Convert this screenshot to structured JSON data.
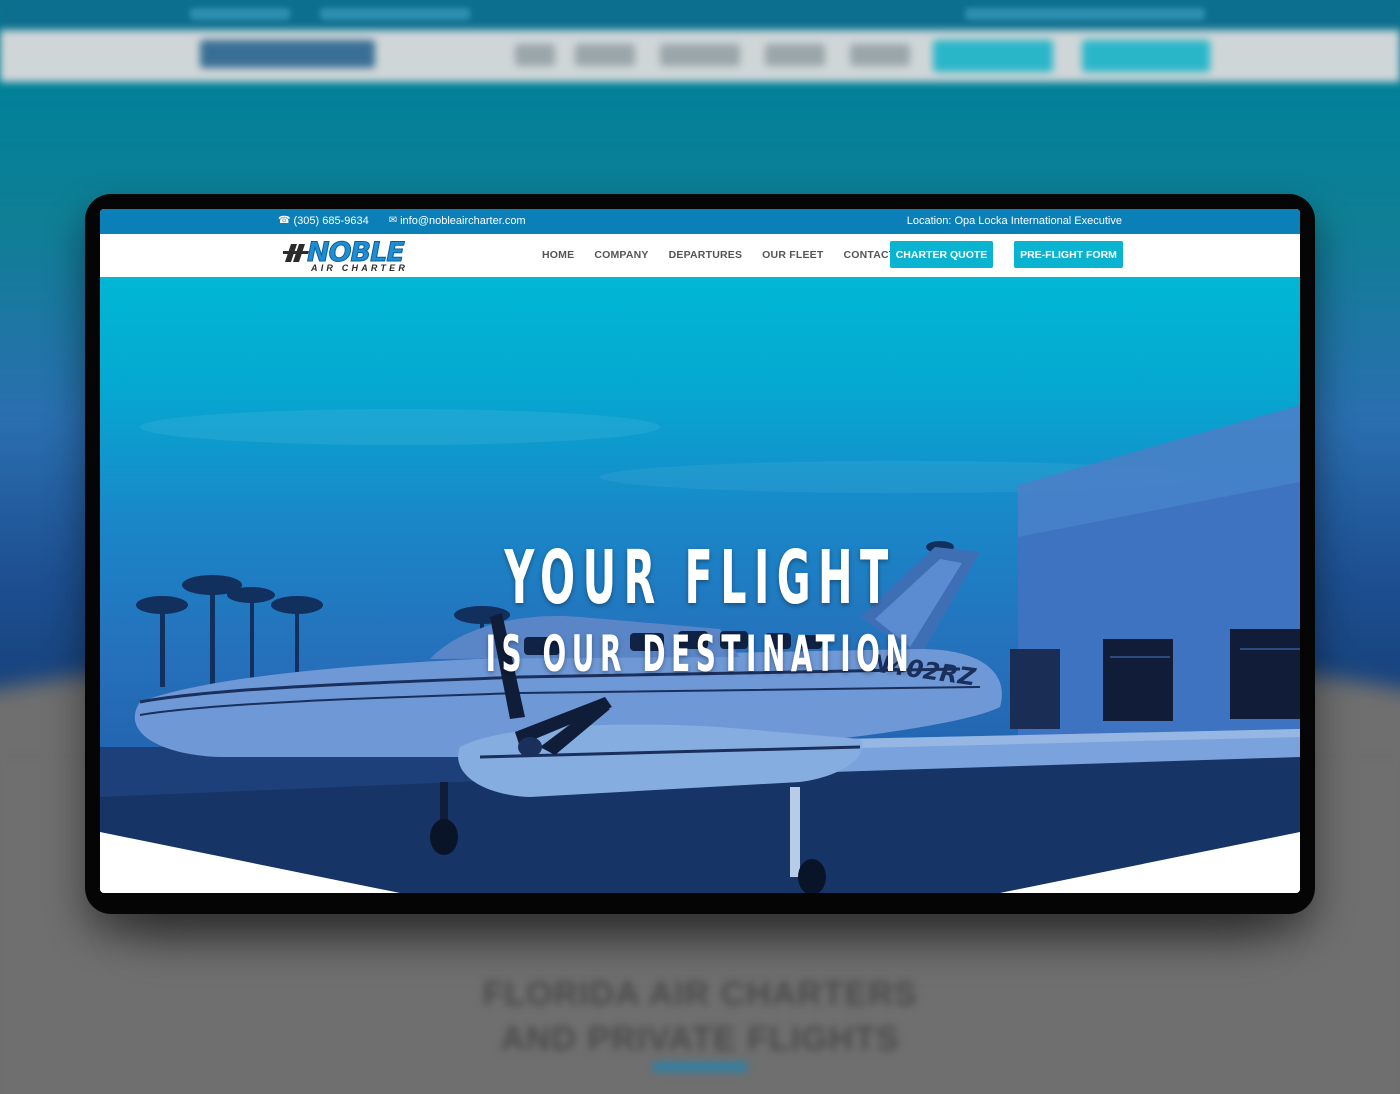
{
  "topbar": {
    "phone": "(305) 685-9634",
    "phone_icon": "phone-icon",
    "email": "info@nobleaircharter.com",
    "email_icon": "envelope-icon",
    "location": "Location: Opa Locka International Executive"
  },
  "brand": {
    "name": "NOBLE",
    "tagline": "AIR CHARTER"
  },
  "nav": {
    "items": [
      "HOME",
      "COMPANY",
      "DEPARTURES",
      "OUR FLEET",
      "CONTACT"
    ],
    "charter_quote": "CHARTER QUOTE",
    "preflight_form": "PRE-FLIGHT FORM"
  },
  "hero": {
    "line1": "YOUR FLIGHT",
    "line2": "IS OUR DESTINATION",
    "tail_number": "N402RZ"
  },
  "colors": {
    "topbar": "#0a7fb8",
    "accent_button": "#0ab3cf",
    "nav_text": "#555555"
  }
}
